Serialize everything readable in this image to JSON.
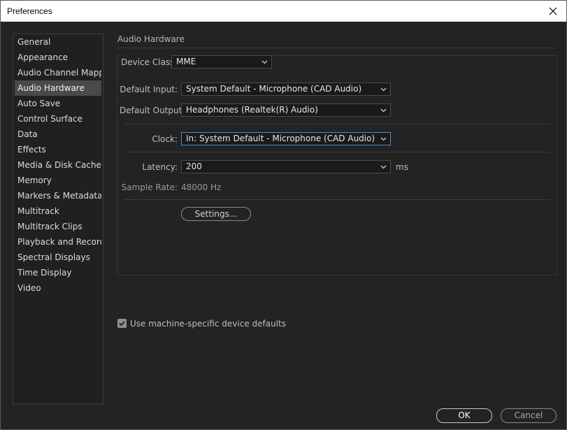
{
  "window": {
    "title": "Preferences"
  },
  "sidebar": {
    "items": [
      {
        "label": "General"
      },
      {
        "label": "Appearance"
      },
      {
        "label": "Audio Channel Mapping"
      },
      {
        "label": "Audio Hardware",
        "selected": true
      },
      {
        "label": "Auto Save"
      },
      {
        "label": "Control Surface"
      },
      {
        "label": "Data"
      },
      {
        "label": "Effects"
      },
      {
        "label": "Media & Disk Cache"
      },
      {
        "label": "Memory"
      },
      {
        "label": "Markers & Metadata"
      },
      {
        "label": "Multitrack"
      },
      {
        "label": "Multitrack Clips"
      },
      {
        "label": "Playback and Recording"
      },
      {
        "label": "Spectral Displays"
      },
      {
        "label": "Time Display"
      },
      {
        "label": "Video"
      }
    ]
  },
  "main": {
    "section_title": "Audio Hardware",
    "device_class": {
      "label": "Device Class:",
      "value": "MME"
    },
    "default_input": {
      "label": "Default Input:",
      "value": "System Default - Microphone (CAD Audio)"
    },
    "default_output": {
      "label": "Default Output:",
      "value": "Headphones (Realtek(R) Audio)"
    },
    "clock": {
      "label": "Clock:",
      "value": "In: System Default - Microphone (CAD Audio)"
    },
    "latency": {
      "label": "Latency:",
      "value": "200",
      "unit": "ms"
    },
    "sample_rate": {
      "label": "Sample Rate:",
      "value": "48000 Hz"
    },
    "settings_label": "Settings...",
    "use_defaults": {
      "label": "Use machine-specific device defaults",
      "checked": true
    }
  },
  "footer": {
    "ok_label": "OK",
    "cancel_label": "Cancel"
  },
  "colors": {
    "accent_focus": "#4a8fd8",
    "selected_bg": "#4a4a4a",
    "background": "#232323"
  }
}
